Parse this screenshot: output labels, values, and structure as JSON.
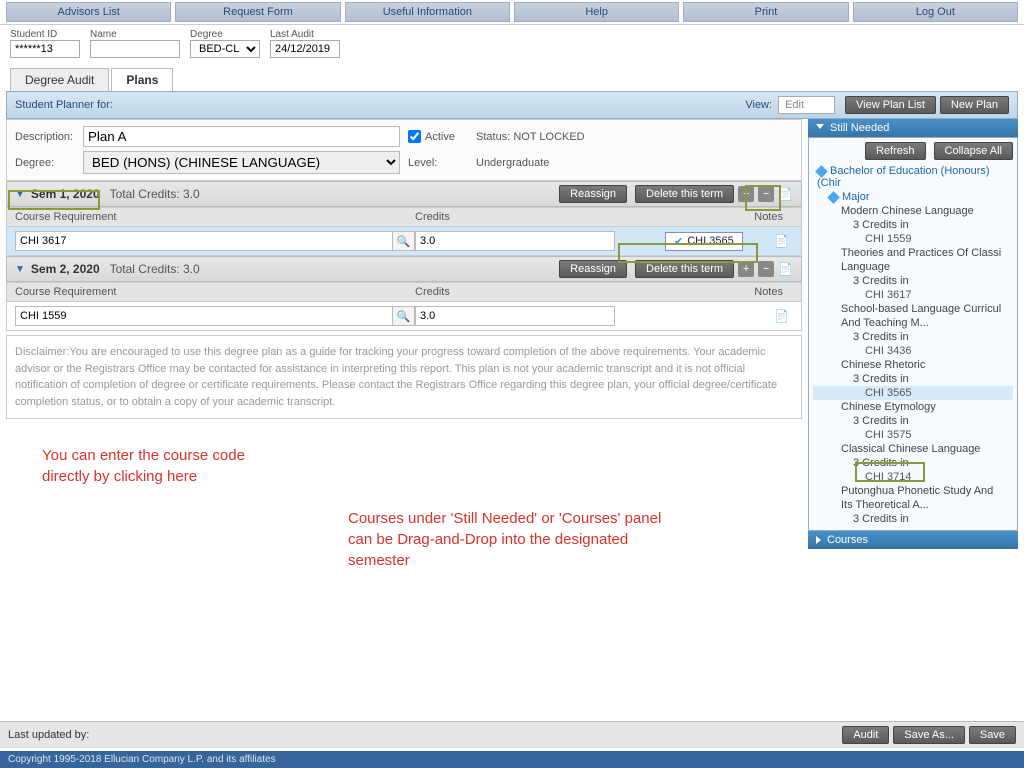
{
  "topnav": [
    "Advisors List",
    "Request Form",
    "Useful Information",
    "Help",
    "Print",
    "Log Out"
  ],
  "info": {
    "student_id_label": "Student ID",
    "student_id": "******13",
    "name_label": "Name",
    "name": "",
    "degree_label": "Degree",
    "degree": "BED-CL",
    "last_audit_label": "Last Audit",
    "last_audit": "24/12/2019"
  },
  "tabs": {
    "degree_audit": "Degree Audit",
    "plans": "Plans"
  },
  "planner": {
    "prefix": "Student Planner for:",
    "view_label": "View:",
    "view_value": "Edit",
    "view_plan_list": "View Plan List",
    "new_plan": "New Plan"
  },
  "details": {
    "desc_label": "Description:",
    "desc": "Plan A",
    "active_label": "Active",
    "status_label": "Status:",
    "status": "NOT LOCKED",
    "degree_label": "Degree:",
    "degree": "BED (HONS) (CHINESE LANGUAGE)",
    "level_label": "Level:",
    "level": "Undergraduate"
  },
  "cols": {
    "c1": "Course Requirement",
    "c2": "Credits",
    "c3": "Notes"
  },
  "btns": {
    "reassign": "Reassign",
    "delete_term": "Delete this term",
    "refresh": "Refresh",
    "collapse": "Collapse All",
    "audit": "Audit",
    "saveas": "Save As...",
    "save": "Save"
  },
  "terms": [
    {
      "name": "Sem 1, 2020",
      "credits_label": "Total Credits: 3.0",
      "rows": [
        {
          "course": "CHI 3617",
          "credits": "3.0",
          "dragchip": "CHI 3565"
        }
      ]
    },
    {
      "name": "Sem 2, 2020",
      "credits_label": "Total Credits: 3.0",
      "rows": [
        {
          "course": "CHI 1559",
          "credits": "3.0"
        }
      ]
    }
  ],
  "disclaimer": "Disclaimer:You are encouraged to use this degree plan as a guide for tracking your progress toward completion of the above requirements. Your academic advisor or the Registrars Office may be contacted for assistance in interpreting this report. This plan is not your academic transcript and it is not official notification of completion of degree or certificate requirements. Please contact the Registrars Office regarding this degree plan, your official degree/certificate completion status, or to obtain a copy of your academic transcript.",
  "side": {
    "still_needed": "Still Needed",
    "courses": "Courses",
    "tree": [
      {
        "t": "Bachelor of Education (Honours) (Chir",
        "lv": 1
      },
      {
        "t": "Major",
        "lv": 2
      },
      {
        "t": "Modern Chinese Language",
        "lv": 3
      },
      {
        "t": "3 Credits in",
        "lv": 4
      },
      {
        "t": "CHI 1559",
        "lv": 5
      },
      {
        "t": "Theories and Practices Of Classi",
        "lv": 3
      },
      {
        "t": "Language",
        "lv": 3
      },
      {
        "t": "3 Credits in",
        "lv": 4
      },
      {
        "t": "CHI 3617",
        "lv": 5
      },
      {
        "t": "School-based Language Curricul",
        "lv": 3
      },
      {
        "t": "And Teaching M...",
        "lv": 3
      },
      {
        "t": "3 Credits in",
        "lv": 4
      },
      {
        "t": "CHI 3436",
        "lv": 5
      },
      {
        "t": "Chinese Rhetoric",
        "lv": 3
      },
      {
        "t": "3 Credits in",
        "lv": 4
      },
      {
        "t": "CHI 3565",
        "lv": 5,
        "sel": true
      },
      {
        "t": "Chinese Etymology",
        "lv": 3
      },
      {
        "t": "3 Credits in",
        "lv": 4
      },
      {
        "t": "CHI 3575",
        "lv": 5
      },
      {
        "t": "Classical Chinese Language",
        "lv": 3
      },
      {
        "t": "3 Credits in",
        "lv": 4
      },
      {
        "t": "CHI 3714",
        "lv": 5
      },
      {
        "t": "Putonghua Phonetic Study And",
        "lv": 3
      },
      {
        "t": "Its Theoretical A...",
        "lv": 3
      },
      {
        "t": "3 Credits in",
        "lv": 4
      }
    ]
  },
  "annot": {
    "a1": "You can enter the course code directly by clicking here",
    "a2": "Courses under 'Still Needed' or 'Courses' panel can be Drag-and-Drop into the designated semester"
  },
  "footer": {
    "last_updated": "Last updated by:",
    "copyright": "Copyright 1995-2018 Ellucian Company L.P. and its affiliates"
  }
}
